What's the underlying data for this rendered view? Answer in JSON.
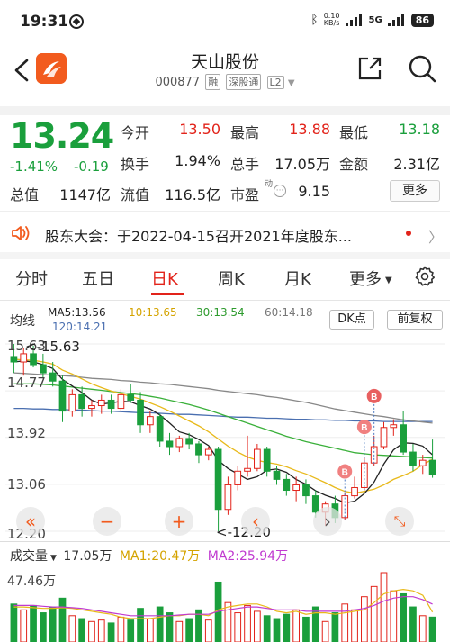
{
  "status_bar": {
    "time": "19:31",
    "net_speed_value": "0.10",
    "net_speed_unit": "KB/s",
    "network": "5G",
    "battery": "86"
  },
  "header": {
    "stock_name": "天山股份",
    "stock_code": "000877",
    "tags": [
      "融",
      "深股通",
      "L2"
    ]
  },
  "quote": {
    "price": "13.24",
    "change_pct": "-1.41%",
    "change": "-0.19",
    "fields": [
      {
        "label": "今开",
        "value": "13.50",
        "color": "red"
      },
      {
        "label": "最高",
        "value": "13.88",
        "color": "red"
      },
      {
        "label": "最低",
        "value": "13.18",
        "color": "green"
      },
      {
        "label": "换手",
        "value": "1.94%",
        "color": "dark"
      },
      {
        "label": "总手",
        "value": "17.05万",
        "color": "dark"
      },
      {
        "label": "金额",
        "value": "2.31亿",
        "color": "dark"
      },
      {
        "label": "总值",
        "value": "1147亿",
        "color": "dark"
      },
      {
        "label": "流值",
        "value": "116.5亿",
        "color": "dark"
      },
      {
        "label": "市盈",
        "value": "9.15",
        "color": "dark"
      }
    ],
    "pe_superscript": "动",
    "more_label": "更多"
  },
  "notice": {
    "text": "股东大会：于2022-04-15召开2021年度股东..."
  },
  "tabs": [
    "分时",
    "五日",
    "日K",
    "周K",
    "月K",
    "更多"
  ],
  "active_tab": "日K",
  "legend": {
    "title": "均线",
    "ma5": "MA5:13.56",
    "ma10": "10:13.65",
    "ma30": "30:13.54",
    "ma60": "60:14.18",
    "ma120": "120:14.21",
    "dk_label": "DK点",
    "adjust_label": "前复权"
  },
  "chart_labels": {
    "y_ticks": [
      "15.63",
      "14.77",
      "13.92",
      "13.06",
      "12.20"
    ],
    "high_marker": "15.63",
    "low_marker": "12.20",
    "signal_label": "B"
  },
  "volume": {
    "label": "成交量",
    "total": "17.05万",
    "ma1": "MA1:20.47万",
    "ma2": "MA2:25.94万",
    "max_label": "47.46万"
  },
  "colors": {
    "up": "#e2231a",
    "down": "#1a9f3c",
    "ma5": "#222222",
    "ma10": "#e8b91a",
    "ma30": "#3ab03a",
    "ma60": "#888888",
    "ma120": "#4a6fb0",
    "accent": "#f25b1e"
  },
  "chart_data": {
    "type": "candlestick",
    "ylim": [
      12.2,
      15.63
    ],
    "y_ticks": [
      15.63,
      14.77,
      13.92,
      13.06,
      12.2
    ],
    "candles": [
      {
        "o": 15.4,
        "h": 15.63,
        "l": 15.1,
        "c": 15.3
      },
      {
        "o": 15.3,
        "h": 15.55,
        "l": 15.05,
        "c": 15.45
      },
      {
        "o": 15.45,
        "h": 15.6,
        "l": 15.2,
        "c": 15.25
      },
      {
        "o": 15.25,
        "h": 15.45,
        "l": 15.0,
        "c": 15.1
      },
      {
        "o": 15.1,
        "h": 15.3,
        "l": 14.85,
        "c": 14.95
      },
      {
        "o": 14.95,
        "h": 15.05,
        "l": 14.2,
        "c": 14.4
      },
      {
        "o": 14.4,
        "h": 14.8,
        "l": 14.3,
        "c": 14.7
      },
      {
        "o": 14.7,
        "h": 14.85,
        "l": 14.3,
        "c": 14.45
      },
      {
        "o": 14.45,
        "h": 14.6,
        "l": 14.3,
        "c": 14.5
      },
      {
        "o": 14.5,
        "h": 14.7,
        "l": 14.35,
        "c": 14.6
      },
      {
        "o": 14.6,
        "h": 14.7,
        "l": 14.35,
        "c": 14.45
      },
      {
        "o": 14.45,
        "h": 14.8,
        "l": 14.4,
        "c": 14.7
      },
      {
        "o": 14.7,
        "h": 14.9,
        "l": 14.55,
        "c": 14.6
      },
      {
        "o": 14.6,
        "h": 14.75,
        "l": 14.0,
        "c": 14.15
      },
      {
        "o": 14.15,
        "h": 14.4,
        "l": 14.0,
        "c": 14.3
      },
      {
        "o": 14.3,
        "h": 14.35,
        "l": 13.75,
        "c": 13.85
      },
      {
        "o": 13.85,
        "h": 14.0,
        "l": 13.6,
        "c": 13.75
      },
      {
        "o": 13.75,
        "h": 13.95,
        "l": 13.65,
        "c": 13.9
      },
      {
        "o": 13.9,
        "h": 14.0,
        "l": 13.7,
        "c": 13.8
      },
      {
        "o": 13.8,
        "h": 13.85,
        "l": 13.45,
        "c": 13.6
      },
      {
        "o": 13.6,
        "h": 13.75,
        "l": 13.5,
        "c": 13.7
      },
      {
        "o": 13.7,
        "h": 13.75,
        "l": 12.2,
        "c": 12.6
      },
      {
        "o": 12.6,
        "h": 13.2,
        "l": 12.5,
        "c": 13.05
      },
      {
        "o": 13.05,
        "h": 13.4,
        "l": 12.95,
        "c": 13.3
      },
      {
        "o": 13.3,
        "h": 13.95,
        "l": 13.2,
        "c": 13.35
      },
      {
        "o": 13.35,
        "h": 13.8,
        "l": 13.3,
        "c": 13.7
      },
      {
        "o": 13.7,
        "h": 13.75,
        "l": 13.2,
        "c": 13.3
      },
      {
        "o": 13.3,
        "h": 13.4,
        "l": 13.05,
        "c": 13.15
      },
      {
        "o": 13.15,
        "h": 13.25,
        "l": 12.85,
        "c": 12.95
      },
      {
        "o": 12.95,
        "h": 13.2,
        "l": 12.75,
        "c": 13.05
      },
      {
        "o": 13.05,
        "h": 13.15,
        "l": 12.7,
        "c": 12.85
      },
      {
        "o": 12.85,
        "h": 12.95,
        "l": 12.45,
        "c": 12.55
      },
      {
        "o": 12.55,
        "h": 12.75,
        "l": 12.3,
        "c": 12.7
      },
      {
        "o": 12.7,
        "h": 12.85,
        "l": 12.35,
        "c": 12.45
      },
      {
        "o": 12.45,
        "h": 12.9,
        "l": 12.4,
        "c": 12.85
      },
      {
        "o": 12.85,
        "h": 13.2,
        "l": 12.8,
        "c": 13.0
      },
      {
        "o": 13.0,
        "h": 13.55,
        "l": 12.95,
        "c": 13.45
      },
      {
        "o": 13.45,
        "h": 13.95,
        "l": 13.4,
        "c": 13.75
      },
      {
        "o": 13.75,
        "h": 14.2,
        "l": 13.7,
        "c": 14.1
      },
      {
        "o": 14.1,
        "h": 14.25,
        "l": 13.95,
        "c": 14.15
      },
      {
        "o": 14.15,
        "h": 14.4,
        "l": 13.6,
        "c": 13.65
      },
      {
        "o": 13.65,
        "h": 13.8,
        "l": 13.3,
        "c": 13.4
      },
      {
        "o": 13.4,
        "h": 13.6,
        "l": 13.25,
        "c": 13.5
      },
      {
        "o": 13.5,
        "h": 13.88,
        "l": 13.18,
        "c": 13.24
      }
    ],
    "ma5": [
      15.3,
      15.32,
      15.3,
      15.25,
      15.18,
      14.98,
      14.86,
      14.74,
      14.6,
      14.53,
      14.55,
      14.58,
      14.57,
      14.5,
      14.44,
      14.33,
      14.18,
      14.02,
      13.97,
      13.88,
      13.77,
      13.5,
      13.35,
      13.25,
      13.15,
      13.2,
      13.32,
      13.34,
      13.28,
      13.15,
      13.06,
      12.94,
      12.86,
      12.8,
      12.72,
      12.75,
      12.89,
      13.1,
      13.43,
      13.69,
      13.82,
      13.81,
      13.76,
      13.6
    ],
    "ma10": [
      15.35,
      15.34,
      15.33,
      15.3,
      15.26,
      15.15,
      15.08,
      14.99,
      14.9,
      14.83,
      14.77,
      14.72,
      14.67,
      14.62,
      14.55,
      14.48,
      14.4,
      14.31,
      14.22,
      14.13,
      14.02,
      13.89,
      13.76,
      13.65,
      13.56,
      13.5,
      13.46,
      13.43,
      13.38,
      13.31,
      13.25,
      13.17,
      13.09,
      13.0,
      12.93,
      12.9,
      12.93,
      12.97,
      13.05,
      13.15,
      13.22,
      13.3,
      13.42,
      13.52
    ],
    "ma30": [
      14.9,
      14.9,
      14.9,
      14.89,
      14.88,
      14.86,
      14.84,
      14.82,
      14.8,
      14.78,
      14.76,
      14.74,
      14.72,
      14.7,
      14.67,
      14.64,
      14.6,
      14.56,
      14.52,
      14.47,
      14.42,
      14.36,
      14.3,
      14.24,
      14.18,
      14.12,
      14.06,
      14.0,
      13.94,
      13.89,
      13.84,
      13.8,
      13.76,
      13.72,
      13.68,
      13.64,
      13.62,
      13.6,
      13.59,
      13.58,
      13.57,
      13.56,
      13.55,
      13.54
    ],
    "ma60": [
      15.1,
      15.09,
      15.08,
      15.07,
      15.06,
      15.05,
      15.04,
      15.02,
      15.0,
      14.99,
      14.98,
      14.96,
      14.95,
      14.93,
      14.92,
      14.9,
      14.89,
      14.87,
      14.85,
      14.83,
      14.81,
      14.78,
      14.76,
      14.74,
      14.72,
      14.7,
      14.67,
      14.65,
      14.62,
      14.59,
      14.56,
      14.52,
      14.48,
      14.44,
      14.41,
      14.38,
      14.35,
      14.32,
      14.3,
      14.27,
      14.24,
      14.22,
      14.2,
      14.18
    ],
    "ma120": [
      14.45,
      14.45,
      14.44,
      14.44,
      14.43,
      14.43,
      14.42,
      14.42,
      14.41,
      14.4,
      14.4,
      14.39,
      14.38,
      14.37,
      14.37,
      14.36,
      14.35,
      14.34,
      14.34,
      14.33,
      14.32,
      14.31,
      14.3,
      14.29,
      14.29,
      14.28,
      14.27,
      14.27,
      14.26,
      14.25,
      14.25,
      14.24,
      14.24,
      14.23,
      14.23,
      14.22,
      14.22,
      14.22,
      14.21,
      14.21,
      14.21,
      14.21,
      14.21,
      14.21
    ],
    "signals": [
      34,
      36,
      37
    ],
    "volume": {
      "max": 47.46,
      "values": [
        26,
        22,
        25,
        20,
        24,
        30,
        18,
        16,
        14,
        15,
        13,
        17,
        15,
        23,
        16,
        24,
        20,
        14,
        16,
        22,
        15,
        41,
        27,
        20,
        25,
        21,
        18,
        16,
        19,
        22,
        17,
        24,
        14,
        20,
        26,
        22,
        31,
        38,
        47.46,
        35,
        33,
        24,
        18,
        17.05
      ],
      "ma1": [
        24,
        24,
        23.5,
        23,
        23,
        23.5,
        23,
        22,
        21,
        20,
        19,
        17,
        16,
        16,
        16,
        17,
        18,
        18,
        19,
        19,
        18,
        22,
        24,
        25,
        26,
        26,
        24,
        21,
        20,
        21,
        19,
        20,
        20,
        19,
        20,
        21,
        22,
        27,
        33,
        35,
        36,
        35,
        32,
        20.47
      ],
      "ma2": [
        25,
        25,
        25,
        24.5,
        24,
        24,
        23.5,
        23,
        22,
        21,
        20,
        19,
        18,
        18,
        18,
        18,
        18,
        18.5,
        19,
        19,
        19,
        21,
        22,
        23,
        24,
        24,
        23,
        22,
        22,
        22,
        21,
        21,
        21,
        21,
        21,
        22,
        23,
        25,
        28,
        30,
        31,
        31,
        29,
        25.94
      ]
    }
  }
}
